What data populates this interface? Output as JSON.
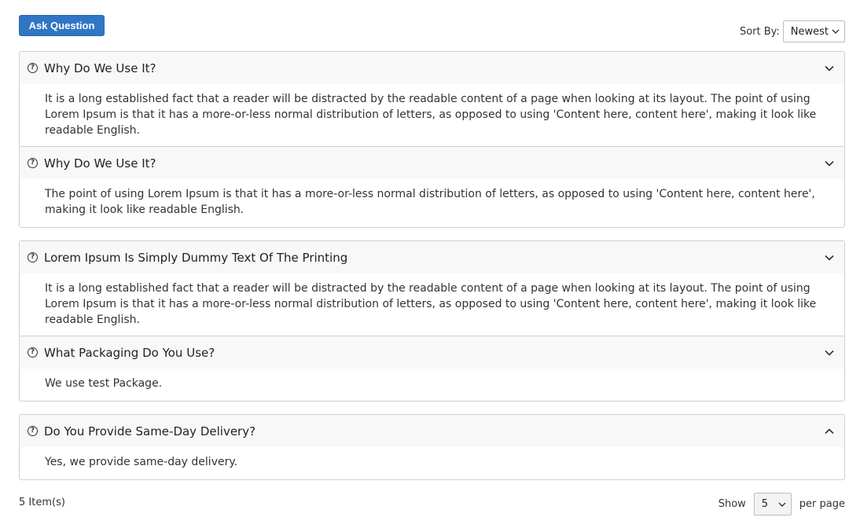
{
  "toolbar": {
    "ask_label": "Ask Question",
    "sort_label": "Sort By:",
    "sort_value": "Newest"
  },
  "faqs": [
    {
      "question": "Why Do We Use It?",
      "answer": "It is a long established fact that a reader will be distracted by the readable content of a page when looking at its layout. The point of using Lorem Ipsum is that it has a more-or-less normal distribution of letters, as opposed to using 'Content here, content here', making it look like readable English.",
      "chevron": "chevron-down-icon"
    },
    {
      "question": "Why Do We Use It?",
      "answer": "The point of using Lorem Ipsum is that it has a more-or-less normal distribution of letters, as opposed to using 'Content here, content here', making it look like readable English.",
      "chevron": "chevron-down-icon"
    },
    {
      "question": "Lorem Ipsum Is Simply Dummy Text Of The Printing",
      "answer": "It is a long established fact that a reader will be distracted by the readable content of a page when looking at its layout. The point of using Lorem Ipsum is that it has a more-or-less normal distribution of letters, as opposed to using 'Content here, content here', making it look like readable English.",
      "chevron": "chevron-down-icon"
    },
    {
      "question": "What Packaging Do You Use?",
      "answer": "We use test Package.",
      "chevron": "chevron-down-icon"
    },
    {
      "question": "Do You Provide Same-Day Delivery?",
      "answer": "Yes, we provide same-day delivery.",
      "chevron": "chevron-up-icon"
    }
  ],
  "footer": {
    "item_count": "5 Item(s)",
    "show_label": "Show",
    "per_page_value": "5",
    "per_page_label": "per page"
  },
  "colors": {
    "primary_button": "#2f76c4",
    "header_bg": "#f8f8f8",
    "border": "#cfcfcf"
  }
}
